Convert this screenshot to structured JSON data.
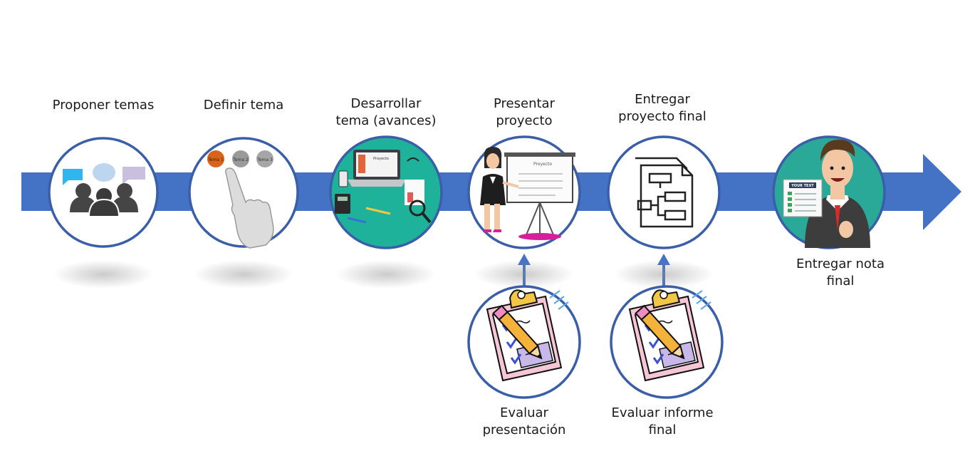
{
  "steps": [
    {
      "label": "Proponer temas",
      "icon": "people-chat-icon"
    },
    {
      "label": "Definir tema",
      "icon": "hand-choose-topic-icon",
      "chips": [
        "Tema 1",
        "Tema 2",
        "Tema 3"
      ]
    },
    {
      "label": "Desarrollar\ntema (avances)",
      "icon": "desk-laptop-icon",
      "screen_text": "Proyecto"
    },
    {
      "label": "Presentar\nproyecto",
      "icon": "presenter-board-icon",
      "board_text": "Proyecto"
    },
    {
      "label": "Entregar\nproyecto final",
      "icon": "document-diagram-icon"
    },
    {
      "label": "Entregar nota\nfinal",
      "icon": "man-report-icon",
      "sheet_text": "YOUR TEXT"
    }
  ],
  "evaluations": [
    {
      "label": "Evaluar\npresentación",
      "icon": "clipboard-pencil-icon"
    },
    {
      "label": "Evaluar informe\nfinal",
      "icon": "clipboard-pencil-icon"
    }
  ],
  "colors": {
    "arrow": "#4472C4",
    "circle_border": "#3A5FA8",
    "text": "#1a1a1a"
  }
}
